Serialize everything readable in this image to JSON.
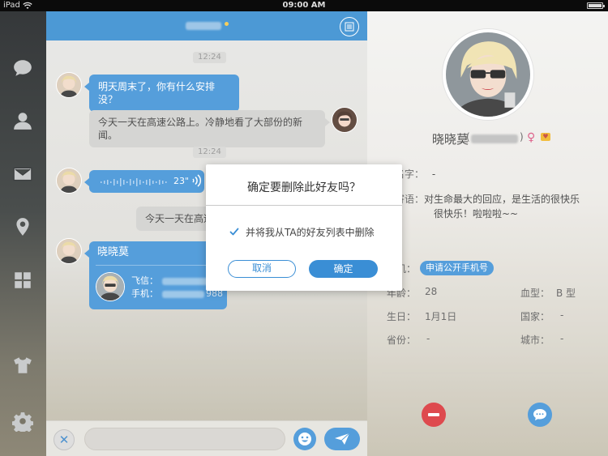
{
  "status_bar": {
    "carrier": "iPad",
    "time": "09:00 AM"
  },
  "sidebar": {
    "items": [
      {
        "icon": "chat-bubble-icon"
      },
      {
        "icon": "contacts-icon"
      },
      {
        "icon": "mail-icon"
      },
      {
        "icon": "location-pin-icon"
      },
      {
        "icon": "grid-apps-icon"
      },
      {
        "icon": "tshirt-icon"
      },
      {
        "icon": "gear-icon"
      }
    ]
  },
  "chat": {
    "messages": [
      {
        "type": "timestamp",
        "text": "12:24"
      },
      {
        "type": "text",
        "side": "left",
        "text": "明天周末了，你有什么安排没？"
      },
      {
        "type": "text",
        "side": "right",
        "text": "今天一天在高速公路上。冷静地看了大部份的新闻。"
      },
      {
        "type": "timestamp",
        "text": "12:24"
      },
      {
        "type": "voice",
        "side": "left",
        "duration": "23\""
      },
      {
        "type": "text",
        "side": "right",
        "text": "今天一天在高速"
      },
      {
        "type": "card",
        "side": "left",
        "name": "晓晓莫",
        "line1_label": "飞信：",
        "line2_label": "手机：",
        "line2_tail": "988"
      }
    ],
    "input": {
      "value": ""
    }
  },
  "profile": {
    "name": "晓晓莫",
    "paren_open": "(",
    "paren_close": ")",
    "gender_symbol": "♀",
    "vip_symbol": "♥",
    "fields": {
      "realname_label": "姓名字：",
      "realname_value": "-",
      "signature_label": "情寄语：",
      "signature_line1": "对生命最大的回应，是生活的很快乐",
      "signature_line2": "很快乐！啦啦啦~~",
      "phone_label": "机：",
      "phone_tag": "申请公开手机号",
      "age_label": "年龄：",
      "age_value": "28",
      "blood_label": "血型：",
      "blood_value": "B 型",
      "birthday_label": "生日：",
      "birthday_value": "1月1日",
      "country_label": "国家：",
      "country_value": "-",
      "province_label": "省份：",
      "province_value": "-",
      "city_label": "城市：",
      "city_value": "-"
    }
  },
  "dialog": {
    "title": "确定要删除此好友吗？",
    "checkbox_label": "并将我从TA的好友列表中删除",
    "checked": true,
    "cancel_label": "取消",
    "confirm_label": "确定"
  },
  "colors": {
    "accent": "#3a8ed5",
    "header": "#2f89cf",
    "danger": "#d92d32",
    "sidebar": "#3c3f40"
  }
}
